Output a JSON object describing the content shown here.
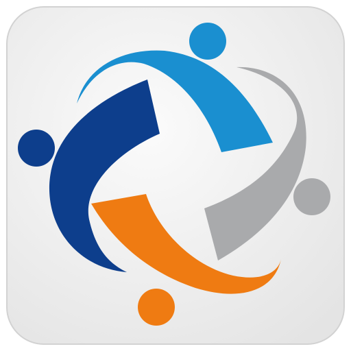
{
  "icon": {
    "name": "community-people-logo",
    "shape": "rounded-square-tile",
    "colors": {
      "tile_light": "#fbfbfb",
      "tile_dark": "#e4e4e4",
      "tile_border": "#d2d2d2",
      "light_blue": "#1a8fd0",
      "dark_blue": "#0d3e8c",
      "gray": "#a9aaac",
      "orange": "#ef7b12"
    },
    "figures": [
      {
        "name": "light-blue-figure",
        "color_key": "light_blue"
      },
      {
        "name": "gray-figure",
        "color_key": "gray"
      },
      {
        "name": "orange-figure",
        "color_key": "orange"
      },
      {
        "name": "dark-blue-figure",
        "color_key": "dark_blue"
      }
    ]
  }
}
